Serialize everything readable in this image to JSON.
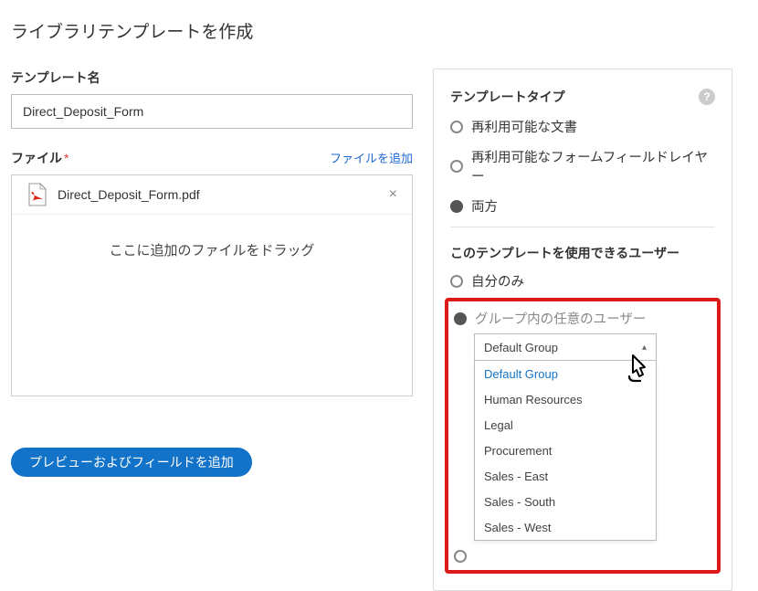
{
  "pageTitle": "ライブラリテンプレートを作成",
  "left": {
    "nameLabel": "テンプレート名",
    "nameValue": "Direct_Deposit_Form",
    "fileLabel": "ファイル",
    "addFile": "ファイルを追加",
    "fileName": "Direct_Deposit_Form.pdf",
    "dropText": "ここに追加のファイルをドラッグ",
    "previewBtn": "プレビューおよびフィールドを追加"
  },
  "right": {
    "typeHeading": "テンプレートタイプ",
    "type1": "再利用可能な文書",
    "type2": "再利用可能なフォームフィールドレイヤー",
    "type3": "両方",
    "userHeading": "このテンプレートを使用できるユーザー",
    "user1": "自分のみ",
    "user2": "グループ内の任意のユーザー",
    "dropdownSelected": "Default Group",
    "dropdownOptions": [
      "Default Group",
      "Human Resources",
      "Legal",
      "Procurement",
      "Sales - East",
      "Sales - South",
      "Sales - West"
    ]
  }
}
